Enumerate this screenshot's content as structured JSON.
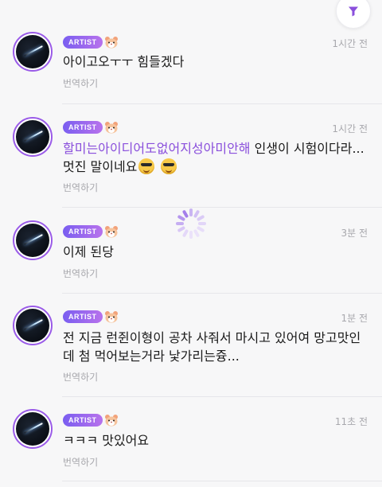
{
  "colors": {
    "accent": "#8a4fdc",
    "badge_gradient_start": "#7a5ef0",
    "badge_gradient_end": "#b872ec",
    "meta_gray": "#a8a8ad"
  },
  "filter": {
    "icon": "filter-icon"
  },
  "posts": [
    {
      "badge": "ARTIST",
      "time": "1시간 전",
      "message": " 아이고오ㅜㅜ 힘들겠다",
      "translate": "번역하기"
    },
    {
      "badge": "ARTIST",
      "time": "1시간 전",
      "mention": "할미는아이디어도없어지성아미안해",
      "message": " 인생이 시험이다라... 멋진 말이네요",
      "emojis": [
        "sunglasses-emoji",
        "sunglasses-emoji"
      ],
      "translate": "번역하기"
    },
    {
      "badge": "ARTIST",
      "time": "3분 전",
      "message": "이제 된당",
      "translate": "번역하기"
    },
    {
      "badge": "ARTIST",
      "time": "1분 전",
      "message": "전 지금 런쥔이형이 공차 사줘서 마시고 있어여 망고맛인데 첨 먹어보는거라 낯가리는즁...",
      "translate": "번역하기"
    },
    {
      "badge": "ARTIST",
      "time": "11초 전",
      "message": "ㅋㅋㅋ 맛있어요",
      "translate": "번역하기"
    }
  ],
  "loading": {
    "icon": "loading-spinner-icon"
  }
}
